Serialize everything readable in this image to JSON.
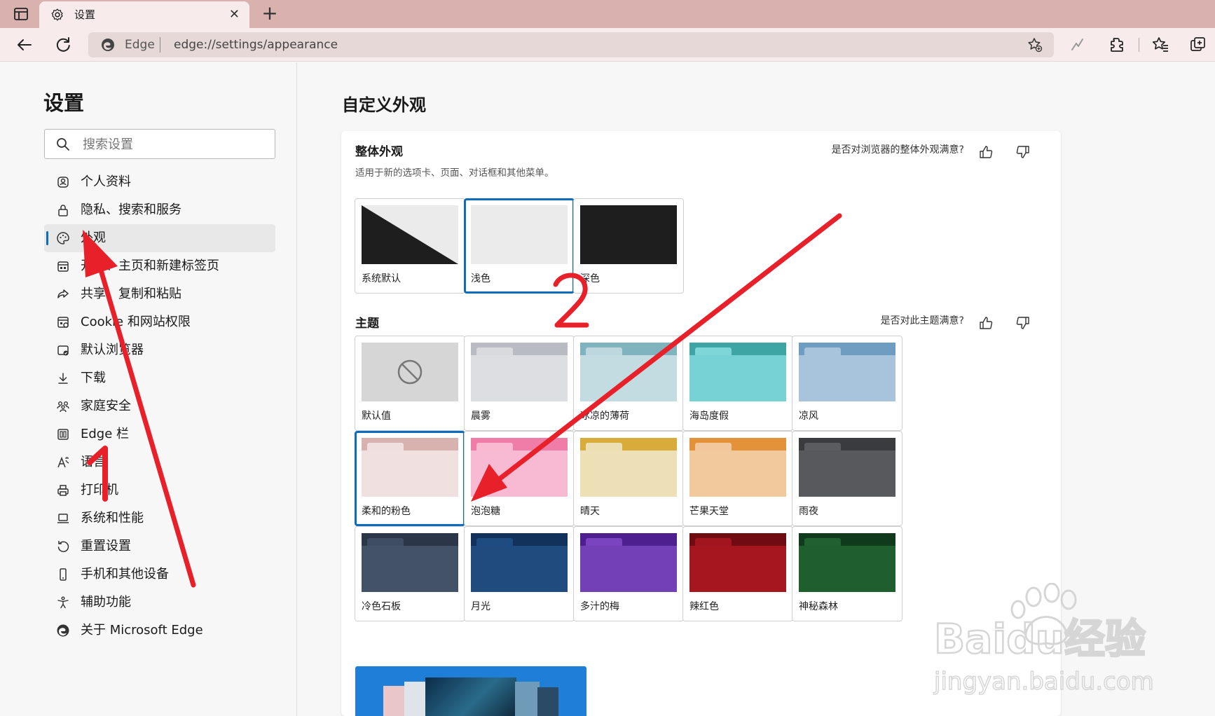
{
  "tab": {
    "title": "设置",
    "close": "✕",
    "new": "+"
  },
  "address": {
    "site": "Edge",
    "url": "edge://settings/appearance"
  },
  "sidebar": {
    "title": "设置",
    "search_placeholder": "搜索设置",
    "items": [
      {
        "label": "个人资料",
        "icon": "profile-icon"
      },
      {
        "label": "隐私、搜索和服务",
        "icon": "lock-icon"
      },
      {
        "label": "外观",
        "icon": "palette-icon",
        "active": true
      },
      {
        "label": "开始、主页和新建标签页",
        "icon": "newtab-icon"
      },
      {
        "label": "共享、复制和粘贴",
        "icon": "share-icon"
      },
      {
        "label": "Cookie 和网站权限",
        "icon": "cookie-icon"
      },
      {
        "label": "默认浏览器",
        "icon": "browser-icon"
      },
      {
        "label": "下载",
        "icon": "download-icon"
      },
      {
        "label": "家庭安全",
        "icon": "family-icon"
      },
      {
        "label": "Edge 栏",
        "icon": "edgebar-icon"
      },
      {
        "label": "语言",
        "icon": "language-icon"
      },
      {
        "label": "打印机",
        "icon": "printer-icon"
      },
      {
        "label": "系统和性能",
        "icon": "laptop-icon"
      },
      {
        "label": "重置设置",
        "icon": "reset-icon"
      },
      {
        "label": "手机和其他设备",
        "icon": "phone-icon"
      },
      {
        "label": "辅助功能",
        "icon": "accessibility-icon"
      },
      {
        "label": "关于 Microsoft Edge",
        "icon": "edge-logo-icon"
      }
    ]
  },
  "main": {
    "title": "自定义外观",
    "overall": {
      "title": "整体外观",
      "desc": "适用于新的选项卡、页面、对话框和其他菜单。",
      "feedback": "是否对浏览器的整体外观满意?",
      "options": [
        {
          "label": "系统默认",
          "kind": "system",
          "selected": false
        },
        {
          "label": "浅色",
          "kind": "light",
          "selected": true
        },
        {
          "label": "深色",
          "kind": "dark",
          "selected": false
        }
      ]
    },
    "theme": {
      "title": "主题",
      "feedback": "是否对此主题满意?",
      "options": [
        {
          "label": "默认值",
          "kind": "default"
        },
        {
          "label": "晨雾",
          "tab": "#b8bcc2",
          "tag": "#d8dadd",
          "body": "#dcdee1"
        },
        {
          "label": "冰凉的薄荷",
          "tab": "#7fb3be",
          "tag": "#bcd7dd",
          "body": "#c3dce1"
        },
        {
          "label": "海岛度假",
          "tab": "#3fa4a4",
          "tag": "#7ed6d8",
          "body": "#76d2d4"
        },
        {
          "label": "凉风",
          "tab": "#6f9cc1",
          "tag": "#a8c3dc",
          "body": "#a7c4dc"
        },
        {
          "label": "柔和的粉色",
          "tab": "#d8b2ae",
          "tag": "#efe0df",
          "body": "#f0e0df",
          "selected": true
        },
        {
          "label": "泡泡糖",
          "tab": "#f07ca8",
          "tag": "#f9b9d1",
          "body": "#f8bad2"
        },
        {
          "label": "晴天",
          "tab": "#d7ac3a",
          "tag": "#ecdfb3",
          "body": "#ede0b6"
        },
        {
          "label": "芒果天堂",
          "tab": "#e3923a",
          "tag": "#f2c79c",
          "body": "#f2c89d"
        },
        {
          "label": "雨夜",
          "tab": "#3a3b3f",
          "tag": "#5b5c60",
          "body": "#58595d"
        },
        {
          "label": "冷色石板",
          "tab": "#2b3648",
          "tag": "#3f4d62",
          "body": "#445268"
        },
        {
          "label": "月光",
          "tab": "#12325b",
          "tag": "#1f4c80",
          "body": "#1f4b7f"
        },
        {
          "label": "多汁的梅",
          "tab": "#4d1f8f",
          "tag": "#7a43c0",
          "body": "#7440b8"
        },
        {
          "label": "辣红色",
          "tab": "#6e0c12",
          "tag": "#a3151e",
          "body": "#a5161f"
        },
        {
          "label": "神秘森林",
          "tab": "#103a1c",
          "tag": "#21602f",
          "body": "#1f5e2d"
        }
      ]
    }
  },
  "annotations": {
    "step1": "1",
    "step2": "2",
    "color": "#e8202a"
  },
  "watermark": {
    "brand": "Baidu经验",
    "url": "jingyan.baidu.com"
  },
  "colors": {
    "accent": "#0f6cbd",
    "tabbar": "#d9b1ae",
    "toolbar": "#f7eceb"
  }
}
